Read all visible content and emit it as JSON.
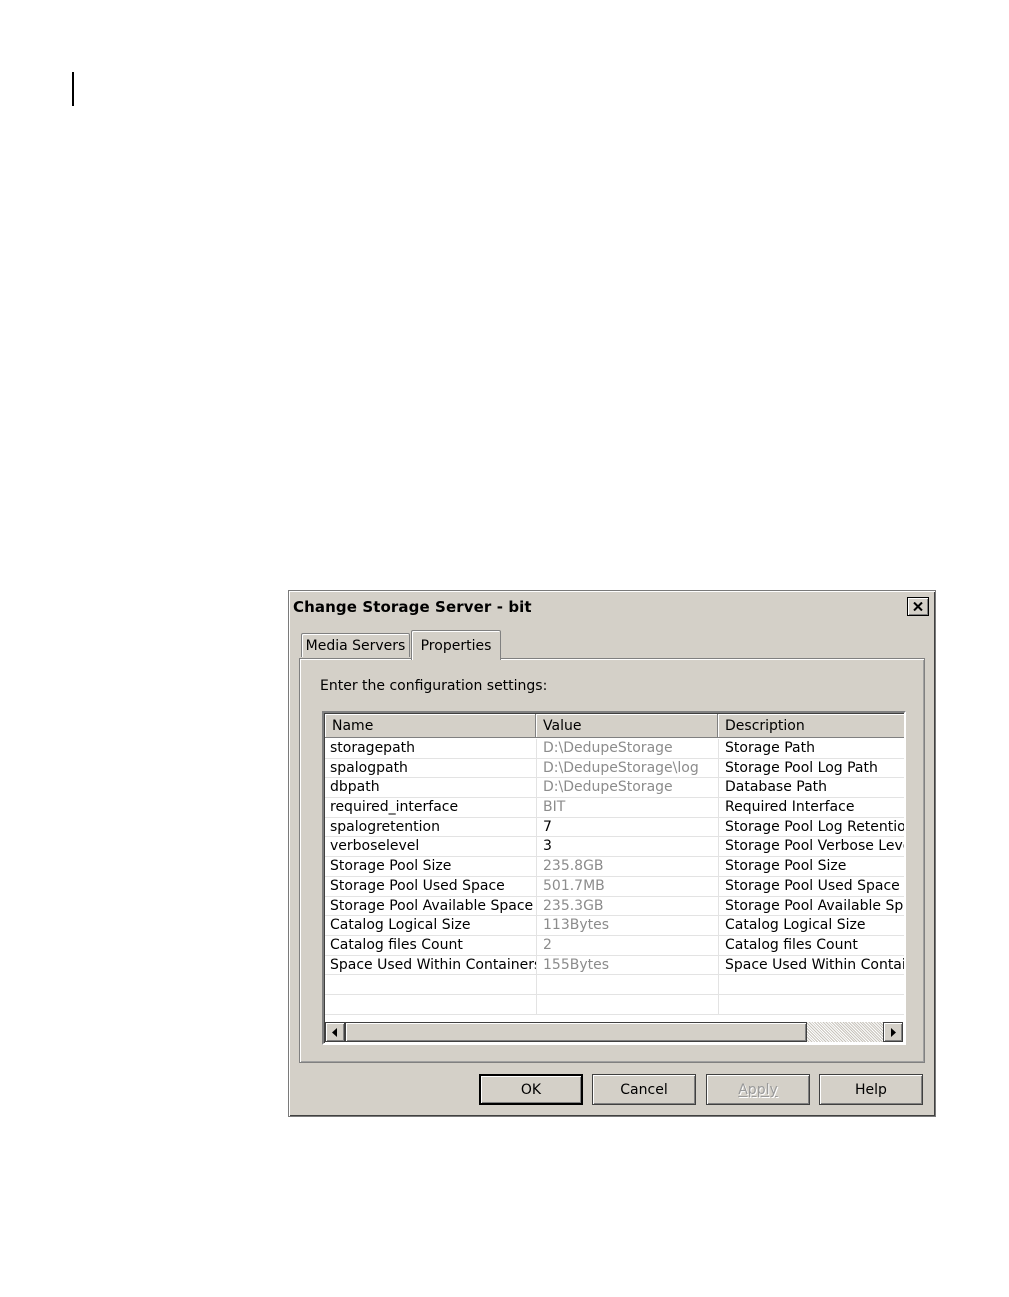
{
  "dialog": {
    "title": "Change Storage Server - bit",
    "close_icon": "close-x-icon"
  },
  "tabs": [
    {
      "label": "Media Servers",
      "active": false
    },
    {
      "label": "Properties",
      "active": true
    }
  ],
  "panel": {
    "instruction": "Enter the configuration settings:"
  },
  "table": {
    "columns": [
      "Name",
      "Value",
      "Description"
    ],
    "rows": [
      {
        "name": "storagepath",
        "value": "D:\\DedupeStorage",
        "description": "Storage Path",
        "value_readonly": true
      },
      {
        "name": "spalogpath",
        "value": "D:\\DedupeStorage\\log",
        "description": "Storage Pool Log Path",
        "value_readonly": true
      },
      {
        "name": "dbpath",
        "value": "D:\\DedupeStorage",
        "description": "Database Path",
        "value_readonly": true
      },
      {
        "name": "required_interface",
        "value": "BIT",
        "description": "Required Interface",
        "value_readonly": true
      },
      {
        "name": "spalogretention",
        "value": "7",
        "description": "Storage Pool Log Retention",
        "value_readonly": false
      },
      {
        "name": "verboselevel",
        "value": "3",
        "description": "Storage Pool Verbose Level",
        "value_readonly": false
      },
      {
        "name": "Storage Pool Size",
        "value": "235.8GB",
        "description": "Storage Pool Size",
        "value_readonly": true
      },
      {
        "name": "Storage Pool Used Space",
        "value": "501.7MB",
        "description": "Storage Pool Used Space",
        "value_readonly": true
      },
      {
        "name": "Storage Pool Available Space",
        "value": "235.3GB",
        "description": "Storage Pool Available Space",
        "value_readonly": true
      },
      {
        "name": "Catalog Logical Size",
        "value": "113Bytes",
        "description": "Catalog Logical Size",
        "value_readonly": true
      },
      {
        "name": "Catalog files Count",
        "value": "2",
        "description": "Catalog files Count",
        "value_readonly": true
      },
      {
        "name": "Space Used Within Containers",
        "value": "155Bytes",
        "description": "Space Used Within Containers",
        "value_readonly": true
      },
      {
        "name": "",
        "value": "",
        "description": ""
      },
      {
        "name": "",
        "value": "",
        "description": ""
      }
    ]
  },
  "buttons": {
    "ok": "OK",
    "cancel": "Cancel",
    "apply": "Apply",
    "help": "Help"
  },
  "scrollbar": {
    "left_icon": "arrow-left-icon",
    "right_icon": "arrow-right-icon"
  }
}
